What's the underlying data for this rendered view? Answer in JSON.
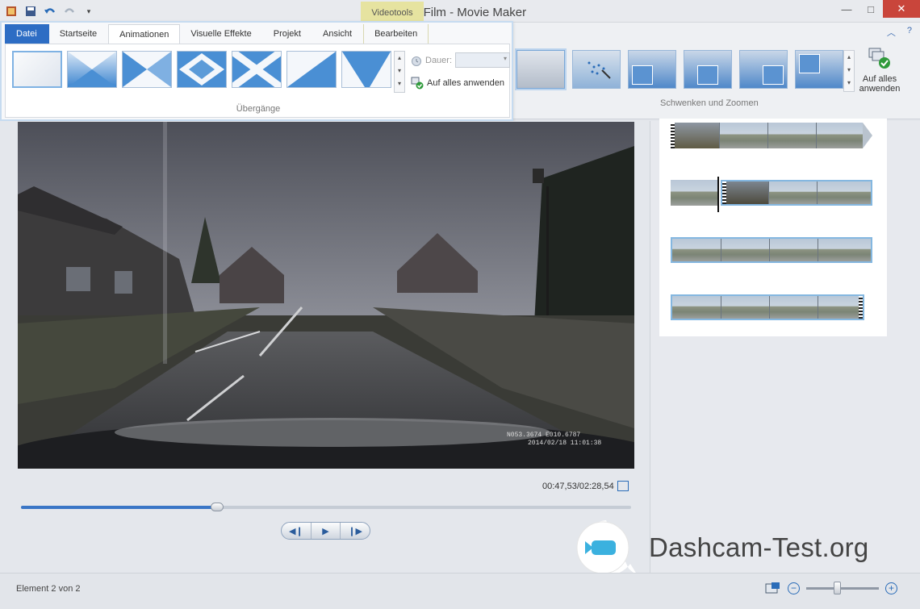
{
  "window": {
    "title": "Mein Film - Movie Maker",
    "context_tab_group": "Videotools"
  },
  "ribbon": {
    "tabs": [
      {
        "label": "Datei"
      },
      {
        "label": "Startseite"
      },
      {
        "label": "Animationen"
      },
      {
        "label": "Visuelle Effekte"
      },
      {
        "label": "Projekt"
      },
      {
        "label": "Ansicht"
      },
      {
        "label": "Bearbeiten"
      }
    ],
    "active_tab": "Animationen",
    "transitions": {
      "group_label": "Übergänge",
      "duration_label": "Dauer:",
      "duration_value": "",
      "apply_all_label": "Auf alles anwenden"
    },
    "pan_zoom": {
      "group_label": "Schwenken und Zoomen",
      "apply_all_line1": "Auf alles",
      "apply_all_line2": "anwenden"
    }
  },
  "preview": {
    "timestamp": "00:47,53/02:28,54",
    "progress": 0.321,
    "video_overlay_line1": "N053.3674 E010.6787",
    "video_overlay_line2": "2014/02/18 11:01:38"
  },
  "status": {
    "element": "Element 2 von 2",
    "zoom_level": 0.42
  },
  "watermark": {
    "text": "Dashcam-Test.org"
  },
  "colors": {
    "accent": "#2d6dc4",
    "close": "#c9453b",
    "context": "#e6e3a0"
  }
}
